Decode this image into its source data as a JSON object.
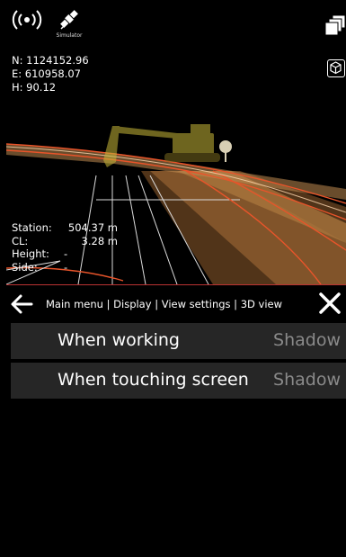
{
  "status": {
    "gps_icon": "gps-signal-icon",
    "satellite_icon": "satellite-icon",
    "satellite_label": "Simulator"
  },
  "coords": {
    "n": "N: 1124152.96",
    "e": "E: 610958.07",
    "h": "H: 90.12"
  },
  "station_info": {
    "station_label": "Station:",
    "station_value": "504.37 m",
    "cl_label": "CL:",
    "cl_value": "3.28 m",
    "height_label": "Height:",
    "height_value": "-",
    "side_label": "Side:",
    "side_value": "-"
  },
  "menubar": {
    "breadcrumb": "Main menu | Display | View settings | 3D view"
  },
  "settings": [
    {
      "label": "When working",
      "value": "Shadow"
    },
    {
      "label": "When touching screen",
      "value": "Shadow"
    }
  ],
  "colors": {
    "accent_line": "#e8542a",
    "row_bg": "#262626",
    "value_text": "#8a8a8a"
  }
}
